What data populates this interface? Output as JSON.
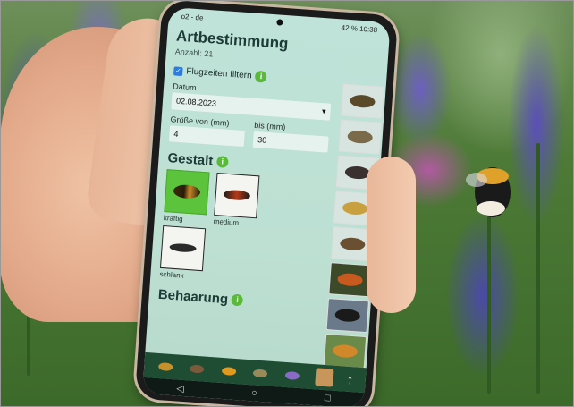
{
  "status_bar": {
    "left": "o2 - de",
    "right": "42 %",
    "time": "10:38"
  },
  "app": {
    "title": "Artbestimmung",
    "count": "Anzahl: 21",
    "filter": {
      "flight_times_label": "Flugzeiten filtern",
      "date_label": "Datum",
      "date_value": "02.08.2023",
      "size_from_label": "Größe von (mm)",
      "size_from_value": "4",
      "size_to_label": "bis (mm)",
      "size_to_value": "30",
      "info_label": "i"
    },
    "sections": {
      "shape": {
        "title": "Gestalt",
        "options": [
          {
            "label": "kräftig",
            "selected": true
          },
          {
            "label": "medium",
            "selected": false
          },
          {
            "label": "schlank",
            "selected": false
          }
        ]
      },
      "hair": {
        "title": "Behaarung"
      }
    }
  },
  "system_nav": {
    "back": "◁",
    "home": "○",
    "recent": "□"
  },
  "bottom_nav": {
    "up": "↑"
  },
  "icons": {
    "info": "info-icon",
    "checkbox": "checkbox-checked-icon",
    "dropdown": "chevron-down-icon"
  },
  "colors": {
    "accent_green": "#5ab83a",
    "nav_bar": "#1f4d33",
    "screen_bg": "#bfe3d8",
    "checkbox_blue": "#2c7be5"
  }
}
